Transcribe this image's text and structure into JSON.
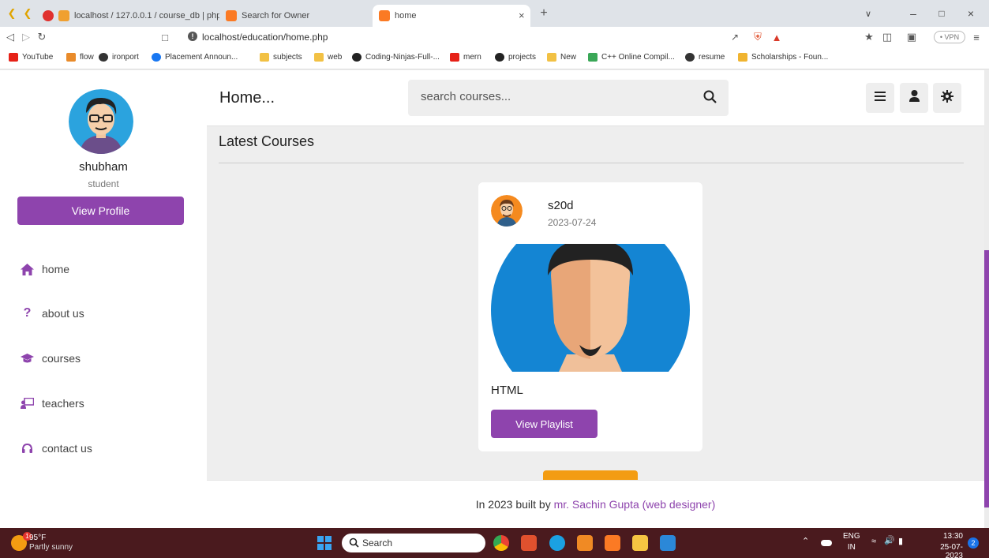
{
  "browser": {
    "tabs": [
      {
        "label": "localhost / 127.0.0.1 / course_db | php"
      },
      {
        "label": "Search for Owner"
      },
      {
        "label": "home"
      }
    ],
    "url": "localhost/education/home.php",
    "vpn_label": "• VPN",
    "bookmarks": [
      {
        "label": "YouTube",
        "icon": "youtube-icon"
      },
      {
        "label": "flow",
        "icon": "flow-icon"
      },
      {
        "label": "ironport",
        "icon": "globe-icon"
      },
      {
        "label": "Placement Announ...",
        "icon": "facebook-icon"
      },
      {
        "label": "subjects",
        "icon": "folder-icon"
      },
      {
        "label": "web",
        "icon": "folder-icon"
      },
      {
        "label": "Coding-Ninjas-Full-...",
        "icon": "github-icon"
      },
      {
        "label": "mern",
        "icon": "youtube-icon"
      },
      {
        "label": "projects",
        "icon": "github-icon"
      },
      {
        "label": "New",
        "icon": "folder-icon"
      },
      {
        "label": "C++ Online Compil...",
        "icon": "compiler-icon"
      },
      {
        "label": "resume",
        "icon": "globe-icon"
      },
      {
        "label": "Scholarships - Foun...",
        "icon": "scholarship-icon"
      }
    ]
  },
  "header": {
    "title": "Home...",
    "search_placeholder": "search courses..."
  },
  "sidebar": {
    "user_name": "shubham",
    "user_role": "student",
    "profile_button": "View Profile",
    "nav": [
      {
        "label": "home",
        "icon": "home-icon"
      },
      {
        "label": "about us",
        "icon": "question-icon"
      },
      {
        "label": "courses",
        "icon": "graduation-cap-icon"
      },
      {
        "label": "teachers",
        "icon": "chalkboard-teacher-icon"
      },
      {
        "label": "contact us",
        "icon": "headset-icon"
      }
    ]
  },
  "main": {
    "section_title": "Latest Courses",
    "courses": [
      {
        "tutor": "s20d",
        "date": "2023-07-24",
        "title": "HTML",
        "button": "View Playlist"
      }
    ]
  },
  "footer": {
    "prefix": "In 2023 built by ",
    "author": "mr. Sachin Gupta (web designer)"
  },
  "taskbar": {
    "weather_temp": "95°F",
    "weather_desc": "Partly sunny",
    "weather_badge": "1",
    "search_label": "Search",
    "lang_top": "ENG",
    "lang_bottom": "IN",
    "time": "13:30",
    "date": "25-07-2023",
    "notif_count": "2"
  },
  "colors": {
    "accent": "#8e44ad",
    "orange": "#f39c12",
    "taskbar": "#4a1a1e"
  }
}
